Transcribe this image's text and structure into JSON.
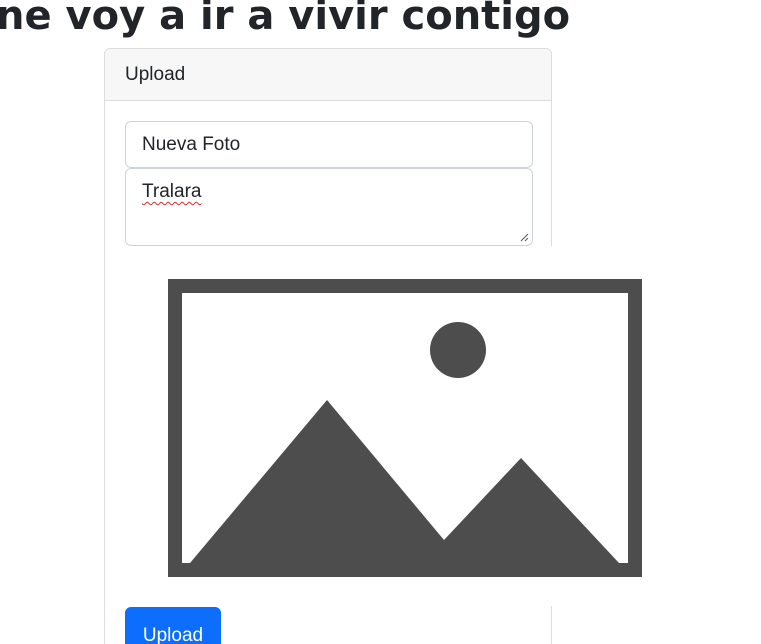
{
  "page": {
    "heading": "ne voy a ir a vivir contigo"
  },
  "upload_card": {
    "header_title": "Upload",
    "title_input": {
      "value": "Nueva Foto"
    },
    "description_textarea": {
      "value": "Tralara"
    },
    "image_preview": {
      "icon": "image-placeholder-icon"
    },
    "upload_button_label": "Upload"
  },
  "colors": {
    "primary_button": "#0d6efd",
    "placeholder_image": "#4d4d4d",
    "spellcheck_underline": "#d32f2f"
  }
}
